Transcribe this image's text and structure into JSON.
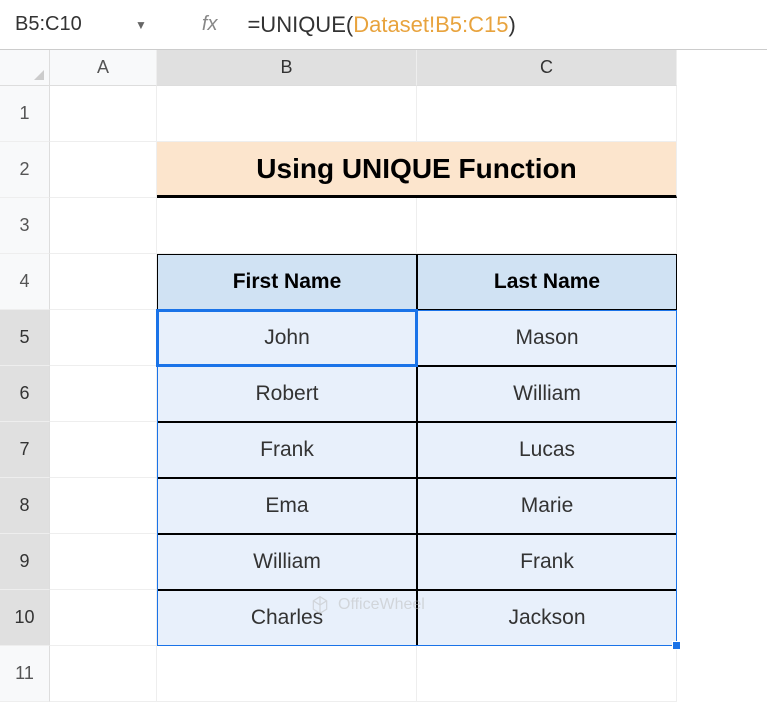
{
  "formula_bar": {
    "name_box": "B5:C10",
    "fx": "fx",
    "formula_prefix": "=UNIQUE(",
    "formula_ref": "Dataset!B5:C15",
    "formula_suffix": ")"
  },
  "columns": [
    "A",
    "B",
    "C"
  ],
  "rows": [
    "1",
    "2",
    "3",
    "4",
    "5",
    "6",
    "7",
    "8",
    "9",
    "10",
    "11"
  ],
  "title": "Using UNIQUE Function",
  "table": {
    "headers": [
      "First Name",
      "Last Name"
    ],
    "data": [
      [
        "John",
        "Mason"
      ],
      [
        "Robert",
        "William"
      ],
      [
        "Frank",
        "Lucas"
      ],
      [
        "Ema",
        "Marie"
      ],
      [
        "William",
        "Frank"
      ],
      [
        "Charles",
        "Jackson"
      ]
    ]
  },
  "watermark": "OfficeWheel"
}
